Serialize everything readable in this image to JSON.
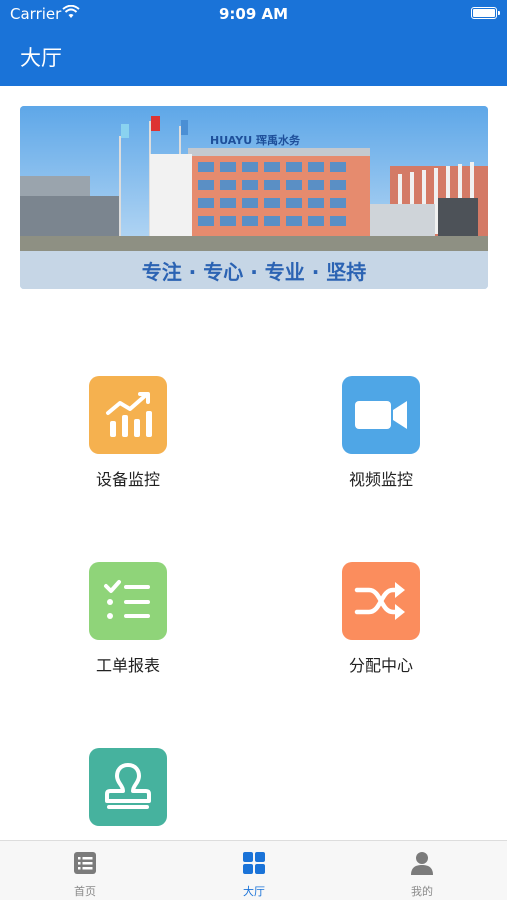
{
  "status_bar": {
    "carrier": "Carrier",
    "time": "9:09 AM"
  },
  "header": {
    "title": "大厅"
  },
  "banner": {
    "slogan": "专注 · 专心 · 专业 · 坚持",
    "sign_text": "HUAYU 珲禹水务"
  },
  "grid": [
    {
      "label": "设备监控",
      "color": "#f5b14f",
      "icon": "bar-chart-icon"
    },
    {
      "label": "视频监控",
      "color": "#4fa6e6",
      "icon": "video-camera-icon"
    },
    {
      "label": "工单报表",
      "color": "#8fd479",
      "icon": "checklist-icon"
    },
    {
      "label": "分配中心",
      "color": "#fb8d5d",
      "icon": "shuffle-icon"
    },
    {
      "label": "",
      "color": "#46b29e",
      "icon": "stamp-icon"
    }
  ],
  "tabbar": {
    "tabs": [
      {
        "label": "首页",
        "icon": "list-icon"
      },
      {
        "label": "大厅",
        "icon": "grid-icon"
      },
      {
        "label": "我的",
        "icon": "person-icon"
      }
    ],
    "active_color": "#1a73d8"
  }
}
